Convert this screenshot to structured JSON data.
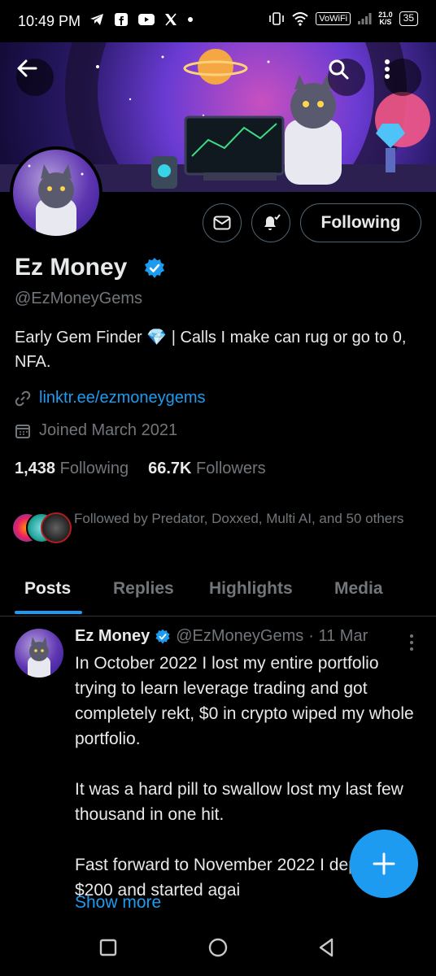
{
  "status_bar": {
    "time": "10:49 PM",
    "vowifi": "VoWiFi",
    "speed_value": "21.0",
    "speed_unit": "K/S",
    "battery": "35"
  },
  "profile": {
    "display_name": "Ez Money",
    "handle": "@EzMoneyGems",
    "bio": "Early Gem Finder 💎 | Calls I make can rug or go to 0, NFA.",
    "link": "linktr.ee/ezmoneygems",
    "joined": "Joined March 2021",
    "following_count": "1,438",
    "following_label": "Following",
    "followers_count": "66.7K",
    "followers_label": "Followers",
    "followed_by": "Followed by Predator, Doxxed, Multi AI, and 50 others",
    "follow_button_label": "Following"
  },
  "tabs": [
    {
      "label": "Posts",
      "active": true
    },
    {
      "label": "Replies",
      "active": false
    },
    {
      "label": "Highlights",
      "active": false
    },
    {
      "label": "Media",
      "active": false
    }
  ],
  "post": {
    "author_name": "Ez Money",
    "author_handle": "@EzMoneyGems",
    "date": "· 11 Mar",
    "text": "In October 2022 I lost my entire portfolio trying to learn leverage trading and got completely rekt, $0 in crypto wiped my whole portfolio.\n\nIt was a hard pill to swallow lost my last few thousand in one hit.\n\nFast forward to November 2022 I deposited $200 and started agai",
    "show_more": "Show more"
  },
  "colors": {
    "accent": "#1d9bf0",
    "muted": "#71767b",
    "text": "#e7e9ea",
    "background": "#000000"
  },
  "icons": {
    "back": "arrow-left-icon",
    "search": "search-icon",
    "more": "more-vertical-icon",
    "message": "envelope-icon",
    "notify": "bell-plus-icon",
    "verified": "verified-badge-icon",
    "link": "link-icon",
    "calendar": "calendar-icon",
    "compose": "plus-icon"
  }
}
